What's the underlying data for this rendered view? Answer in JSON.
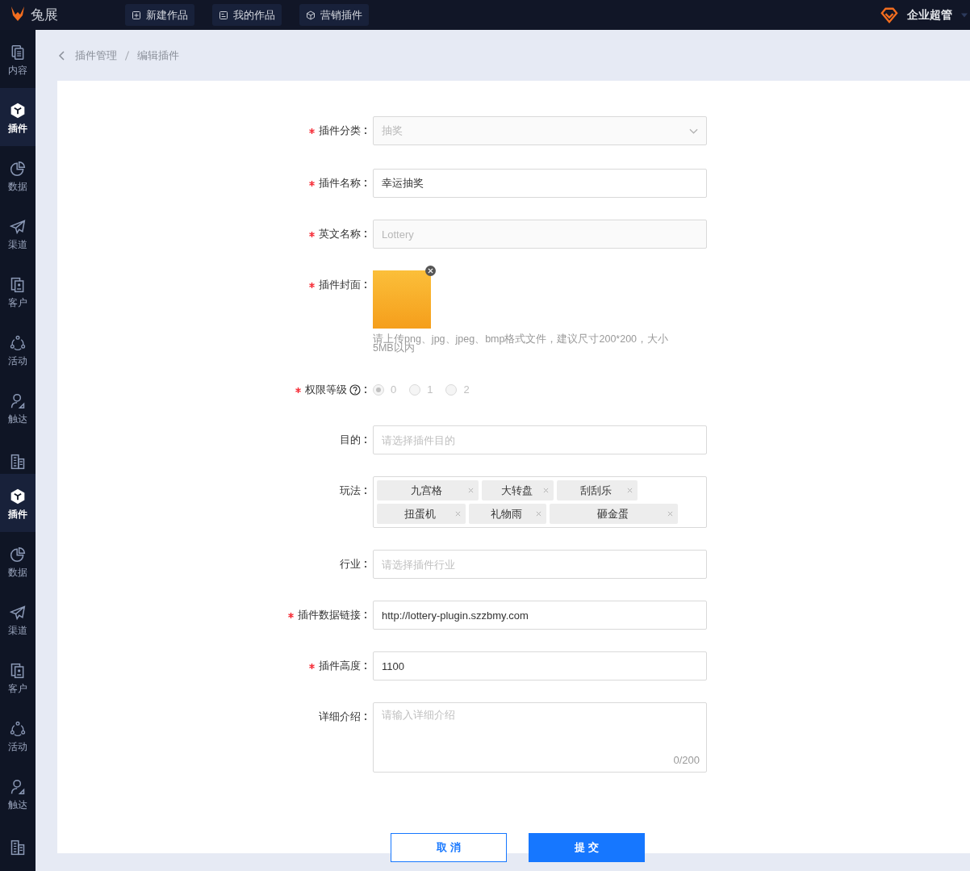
{
  "topbar": {
    "brand": "兔展",
    "nav": [
      {
        "kind": "new",
        "label": "新建作品"
      },
      {
        "kind": "mine",
        "label": "我的作品"
      },
      {
        "kind": "plugin",
        "label": "营销插件"
      }
    ],
    "user": "企业超管"
  },
  "sidebar": {
    "items": [
      {
        "kind": "content",
        "label": "内容",
        "selected": false
      },
      {
        "kind": "plugin",
        "label": "插件",
        "selected": true
      },
      {
        "kind": "data",
        "label": "数据",
        "selected": false
      },
      {
        "kind": "channel",
        "label": "渠道",
        "selected": false
      },
      {
        "kind": "customer",
        "label": "客户",
        "selected": false
      },
      {
        "kind": "activity",
        "label": "活动",
        "selected": false
      },
      {
        "kind": "reach",
        "label": "触达",
        "selected": false
      },
      {
        "kind": "building",
        "selected": false
      },
      {
        "kind": "plugin",
        "label": "插件",
        "selected": true
      },
      {
        "kind": "data",
        "label": "数据",
        "selected": false
      },
      {
        "kind": "channel",
        "label": "渠道",
        "selected": false
      },
      {
        "kind": "customer",
        "label": "客户",
        "selected": false
      },
      {
        "kind": "activity",
        "label": "活动",
        "selected": false
      },
      {
        "kind": "reach",
        "label": "触达",
        "selected": false
      },
      {
        "kind": "building",
        "selected": false
      }
    ]
  },
  "breadcrumb": [
    "插件管理",
    "编辑插件"
  ],
  "form": {
    "fields": [
      {
        "kind": "select",
        "label": "插件分类",
        "required": true,
        "value": "抽奖",
        "disabled": true
      },
      {
        "kind": "input",
        "label": "插件名称",
        "required": true,
        "value": "幸运抽奖"
      },
      {
        "kind": "input",
        "label": "英文名称",
        "required": true,
        "value": "Lottery",
        "disabled": true
      },
      {
        "kind": "upload",
        "label": "插件封面",
        "required": true,
        "hint": "请上传png、jpg、jpeg、bmp格式文件，建议尺寸200*200，大小5MB以内"
      },
      {
        "kind": "radio",
        "label": "权限等级",
        "required": true,
        "help": true,
        "disabled": true,
        "options": [
          {
            "label": "0",
            "selected": true
          },
          {
            "label": "1",
            "selected": false
          },
          {
            "label": "2",
            "selected": false
          }
        ]
      },
      {
        "kind": "input",
        "label": "目的",
        "placeholder": "请选择插件目的"
      },
      {
        "kind": "tags",
        "label": "玩法",
        "tags": [
          "九宫格",
          "大转盘",
          "刮刮乐",
          "扭蛋机",
          "礼物雨",
          "砸金蛋"
        ]
      },
      {
        "kind": "input",
        "label": "行业",
        "placeholder": "请选择插件行业"
      },
      {
        "kind": "input",
        "label": "插件数据链接",
        "required": true,
        "value": "http://lottery-plugin.szzbmy.com"
      },
      {
        "kind": "input",
        "label": "插件高度",
        "required": true,
        "value": "1100"
      },
      {
        "kind": "textarea",
        "label": "详细介绍",
        "placeholder": "请输入详细介绍",
        "counter": "0/200"
      }
    ]
  },
  "buttons": [
    {
      "kind": "secondary",
      "label": "取 消"
    },
    {
      "kind": "primary",
      "label": "提 交"
    }
  ]
}
